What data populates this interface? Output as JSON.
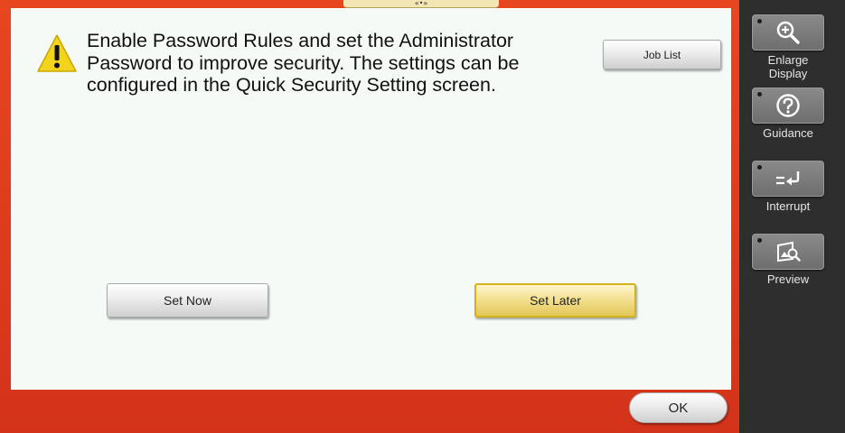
{
  "top_tab": {
    "handle": "«•»"
  },
  "dialog": {
    "message": "Enable Password Rules and set the Administrator\nPassword to improve security. The settings can be\nconfigured in the Quick Security Setting screen.",
    "job_list_label": "Job List",
    "set_now_label": "Set Now",
    "set_later_label": "Set Later",
    "ok_label": "OK"
  },
  "sidebar": {
    "items": [
      {
        "label": "Enlarge\nDisplay",
        "icon": "zoom-in-icon"
      },
      {
        "label": "Guidance",
        "icon": "question-icon"
      },
      {
        "label": "Interrupt",
        "icon": "interrupt-icon"
      },
      {
        "label": "Preview",
        "icon": "preview-icon"
      }
    ]
  },
  "colors": {
    "frame_red": "#d9381a",
    "panel_bg": "#f5faf6",
    "selected_button": "#f1dc86",
    "sidebar_bg": "#2e2e2e"
  }
}
